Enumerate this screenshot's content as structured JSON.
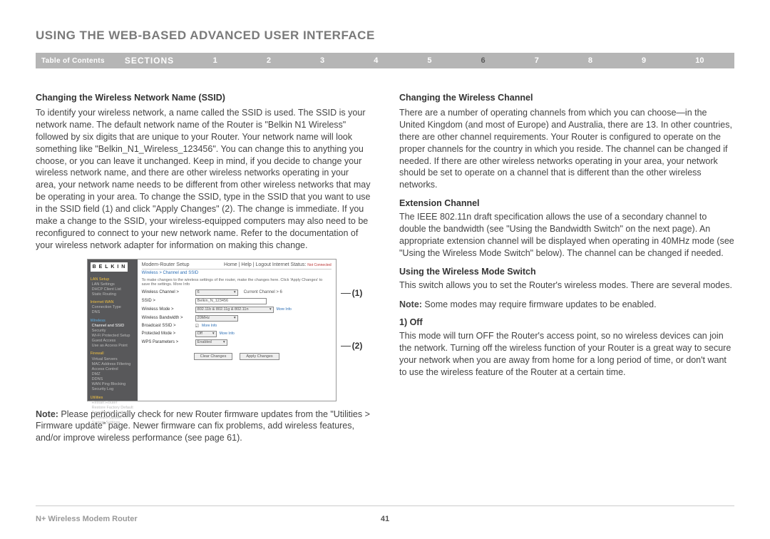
{
  "title": "USING THE WEB-BASED ADVANCED USER INTERFACE",
  "nav": {
    "toc": "Table of Contents",
    "sections": "SECTIONS",
    "nums": [
      "1",
      "2",
      "3",
      "4",
      "5",
      "6",
      "7",
      "8",
      "9",
      "10"
    ],
    "active": "6"
  },
  "left": {
    "h1": "Changing the Wireless Network Name (SSID)",
    "p1": "To identify your wireless network, a name called the SSID  is used. The SSID is your network name. The default network name of the Router is \"Belkin N1 Wireless\" followed by six digits that are unique to your Router. Your network name will look something like \"Belkin_N1_Wireless_123456\". You can change this to anything you choose, or you can leave it unchanged. Keep in mind, if you decide to change your wireless network name, and there are other wireless networks operating in your area, your network name needs to be different from other wireless networks that may be operating in your area. To change the SSID, type in the SSID that you want to use in the SSID field (1) and click \"Apply Changes\" (2). The change is immediate. If you make a change to the SSID, your wireless-equipped computers may also need to be reconfigured to connect to your new network name. Refer to the documentation of your wireless network adapter for information on making this change.",
    "noteLabel": "Note:",
    "noteText": " Please periodically check for new Router firmware updates from the \"Utilities > Firmware update\" page. Newer firmware can fix problems, add wireless features, and/or improve wireless performance (see page 61).",
    "callout1": "(1)",
    "callout2": "(2)"
  },
  "right": {
    "h1": "Changing the Wireless Channel",
    "p1": "There are a number of operating channels from which you can choose—in the United Kingdom (and most of Europe) and Australia, there are 13. In other countries, there are other channel requirements. Your Router is configured to operate on the proper channels for the country in which you reside. The channel can be changed if needed. If there are other wireless networks operating in your area, your network should be set to operate on a channel that is different than the other wireless networks.",
    "h2": "Extension Channel",
    "p2": "The IEEE 802.11n draft specification allows the use of a secondary channel to double the bandwidth (see \"Using the Bandwidth Switch\" on the next page). An appropriate extension channel will be displayed when operating in 40MHz mode (see \"Using the Wireless Mode Switch\" below). The channel can be changed if needed.",
    "h3": "Using the Wireless Mode Switch",
    "p3": "This switch allows you to set the Router's wireless modes. There are several modes.",
    "noteLabel": "Note:",
    "noteText": " Some modes may require firmware updates to be enabled.",
    "h4": "1) Off",
    "p4": "This mode will turn OFF the Router's access point, so no wireless devices can join the network. Turning off the wireless function of your Router is a great way to secure your network when you are away from home for a long period of time, or don't want to use the wireless feature of the Router at a certain time."
  },
  "screenshot": {
    "logo": "B E L K I N",
    "mainTitle": "Modem-Router Setup",
    "topRight": "Home | Help | Logout   Internet Status: ",
    "topRightStatus": "Not Connected",
    "breadcrumb": "Wireless > Channel and SSID",
    "desc": "To make changes to the wireless settings of the router, make the changes here. Click 'Apply Changes' to save the settings. More Info",
    "sidebar": {
      "cat1": "LAN Setup",
      "i1a": "LAN Settings",
      "i1b": "DHCP Client List",
      "i1c": "Static Routing",
      "cat2": "Internet WAN",
      "i2a": "Connection Type",
      "i2b": "DNS",
      "wcat": "Wireless",
      "w1": "Channel and SSID",
      "w2": "Security",
      "w3": "Wi-Fi Protected Setup",
      "w4": "Guest Access",
      "w5": "Use as Access Point",
      "cat3": "Firewall",
      "f1": "Virtual Servers",
      "f2": "MAC Address Filtering",
      "f3": "Access Control",
      "f4": "DMZ",
      "f5": "DDNS",
      "f6": "WAN Ping Blocking",
      "f7": "Security Log",
      "cat4": "Utilities",
      "u1": "Restart Router",
      "u2": "Restore Factory Default",
      "u3": "Save/Backup Settings",
      "u4": "Firmware Update",
      "u5": "System Settings"
    },
    "rows": {
      "r1l": "Wireless Channel >",
      "r1v": "6",
      "r1x": "Current Channel > 6",
      "r2l": "SSID >",
      "r2v": "Belkin_N_123456",
      "r3l": "Wireless Mode >",
      "r3v": "802.11b & 802.11g & 802.11n",
      "r3i": "More Info",
      "r4l": "Wireless Bandwidth >",
      "r4v": "20MHz",
      "r5l": "Broadcast SSID >",
      "r5i": "More Info",
      "r6l": "Protected Mode >",
      "r6v": "Off",
      "r6i": "More Info",
      "r7l": "WPS Parameters >",
      "r7v": "Enabled"
    },
    "btn1": "Clear Changes",
    "btn2": "Apply Changes"
  },
  "footer": {
    "left": "N+ Wireless Modem Router",
    "page": "41"
  }
}
